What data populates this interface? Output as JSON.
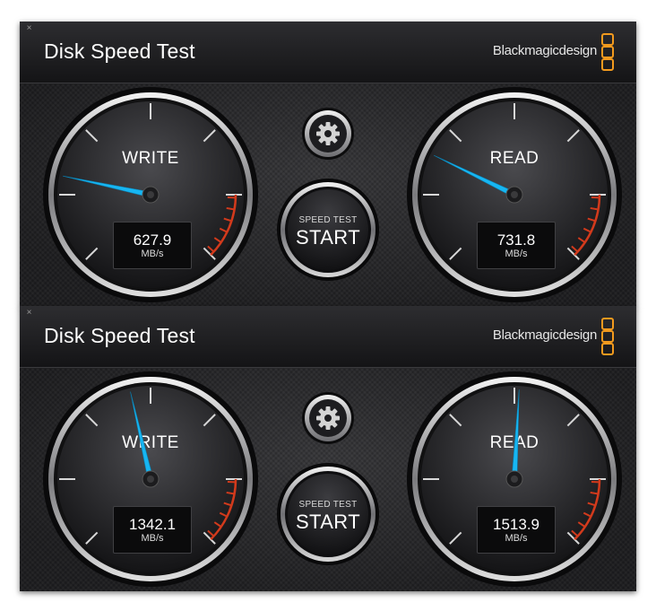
{
  "colors": {
    "needle": "#17b6f2",
    "redline": "#d23a1c",
    "logo": "#f29a1e"
  },
  "windows": [
    {
      "title": "Disk Speed Test",
      "brand": "Blackmagicdesign",
      "start_button": {
        "caption": "SPEED TEST",
        "label": "START"
      },
      "gauges": [
        {
          "label": "WRITE",
          "value": "627.9",
          "unit": "MB/s",
          "needle_angle": -78
        },
        {
          "label": "READ",
          "value": "731.8",
          "unit": "MB/s",
          "needle_angle": -64
        }
      ]
    },
    {
      "title": "Disk Speed Test",
      "brand": "Blackmagicdesign",
      "start_button": {
        "caption": "SPEED TEST",
        "label": "START"
      },
      "gauges": [
        {
          "label": "WRITE",
          "value": "1342.1",
          "unit": "MB/s",
          "needle_angle": -13
        },
        {
          "label": "READ",
          "value": "1513.9",
          "unit": "MB/s",
          "needle_angle": 3
        }
      ]
    }
  ]
}
